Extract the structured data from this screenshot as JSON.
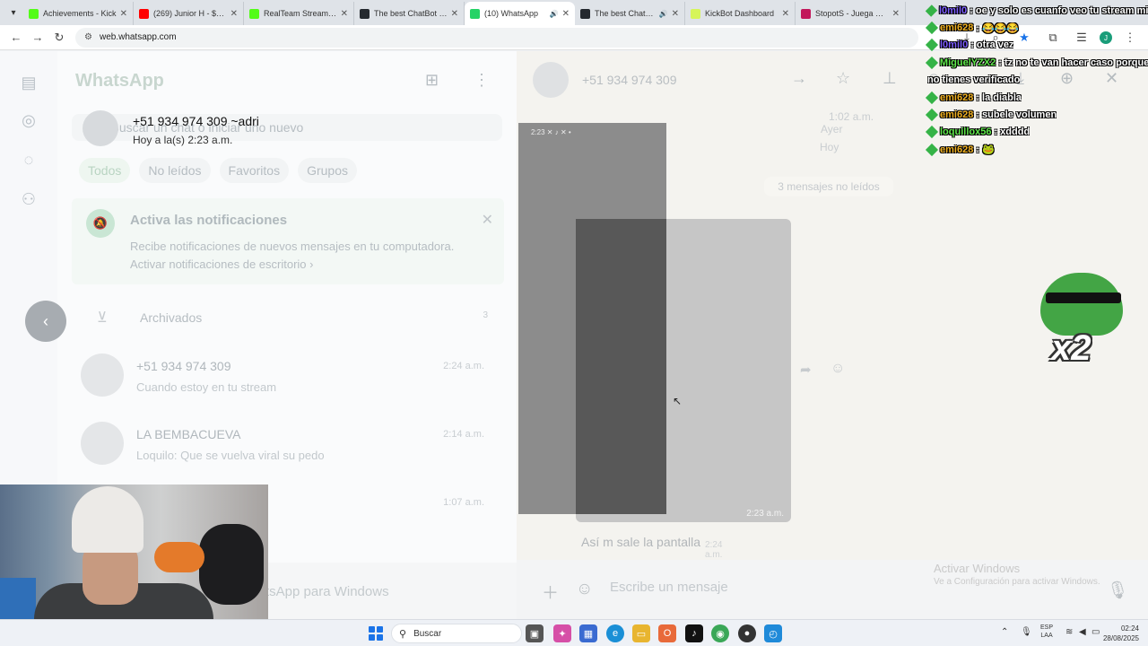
{
  "browser": {
    "tabs": [
      {
        "label": "Achievements - Kick",
        "favicon_color": "#53fc18",
        "active": false,
        "audio": false
      },
      {
        "label": "(269) Junior H - $AD",
        "favicon_color": "#ff0000",
        "active": false,
        "audio": false
      },
      {
        "label": "RealTeam Stream - W",
        "favicon_color": "#53fc18",
        "active": false,
        "audio": false
      },
      {
        "label": "The best ChatBot an",
        "favicon_color": "#24292f",
        "active": false,
        "audio": false
      },
      {
        "label": "(10) WhatsApp",
        "favicon_color": "#25d366",
        "active": true,
        "audio": true
      },
      {
        "label": "The best ChatBot",
        "favicon_color": "#24292f",
        "active": false,
        "audio": true
      },
      {
        "label": "KickBot Dashboard",
        "favicon_color": "#d6f55a",
        "active": false,
        "audio": false
      },
      {
        "label": "StopotS - Juega Stop",
        "favicon_color": "#c2185b",
        "active": false,
        "audio": false
      }
    ],
    "address": "web.whatsapp.com"
  },
  "whatsapp": {
    "logo": "WhatsApp",
    "overlay_contact": {
      "name": "+51 934 974 309 ~adri",
      "last_seen": "Hoy a la(s) 2:23 a.m."
    },
    "search_placeholder": "Buscar un chat o iniciar uno nuevo",
    "filters": [
      "Todos",
      "No leídos",
      "Favoritos",
      "Grupos"
    ],
    "notification": {
      "title": "Activa las notificaciones",
      "body": "Recibe notificaciones de nuevos mensajes en tu computadora.",
      "link": "Activar notificaciones de escritorio ›"
    },
    "archived": {
      "label": "Archivados",
      "count": "3"
    },
    "chats": [
      {
        "name": "+51 934 974 309",
        "preview": "Cuando estoy en tu stream",
        "time": "2:24 a.m."
      },
      {
        "name": "LA BEMBACUEVA",
        "preview": "Loquilo: Que se vuelva viral su pedo",
        "time": "2:14 a.m."
      },
      {
        "name": "",
        "preview": "",
        "time": "1:07 a.m."
      }
    ],
    "footer_text": "tsApp para Windows",
    "conversation": {
      "name": "+51 934 974 309",
      "dates": [
        "1:02 a.m.",
        "Ayer",
        "Hoy"
      ],
      "unread_label": "3 mensajes no leídos",
      "media_time": "2:23 a.m.",
      "media_status": "2:23 ✕ ♪ ✕ •",
      "text_message": {
        "body": "Así m sale la pantalla",
        "time": "2:24 a.m."
      },
      "composer_placeholder": "Escribe un mensaje"
    }
  },
  "activate_windows": {
    "title": "Activar Windows",
    "subtitle": "Ve a Configuración para activar Windows."
  },
  "stream_chat": [
    {
      "user": "l0mil0",
      "text": ": oe y solo es cuanfo veo tu stream mierda",
      "user_color": "#7c5cff"
    },
    {
      "user": "emi628",
      "text": ": 😂😂😂",
      "user_color": "#f0b020"
    },
    {
      "user": "l0mil0",
      "text": ": otra vez",
      "user_color": "#7c5cff"
    },
    {
      "user": "MiguelYZX2",
      "text": ": tz no te van hacer caso porque",
      "user_color": "#5fe84a"
    },
    {
      "user": "",
      "text": "no tienes verificado",
      "user_color": "#ffffff"
    },
    {
      "user": "emi628",
      "text": ": la diabla",
      "user_color": "#f0b020"
    },
    {
      "user": "emi628",
      "text": ": subele volumen",
      "user_color": "#f0b020"
    },
    {
      "user": "loquillox56",
      "text": ": xdddd",
      "user_color": "#5fe84a"
    },
    {
      "user": "emi628",
      "text": ": 🐸",
      "user_color": "#f0b020"
    }
  ],
  "emote_text": "x2",
  "taskbar": {
    "search_label": "Buscar",
    "lang_line1": "ESP",
    "lang_line2": "LAA",
    "time": "02:24",
    "date": "28/08/2025"
  }
}
